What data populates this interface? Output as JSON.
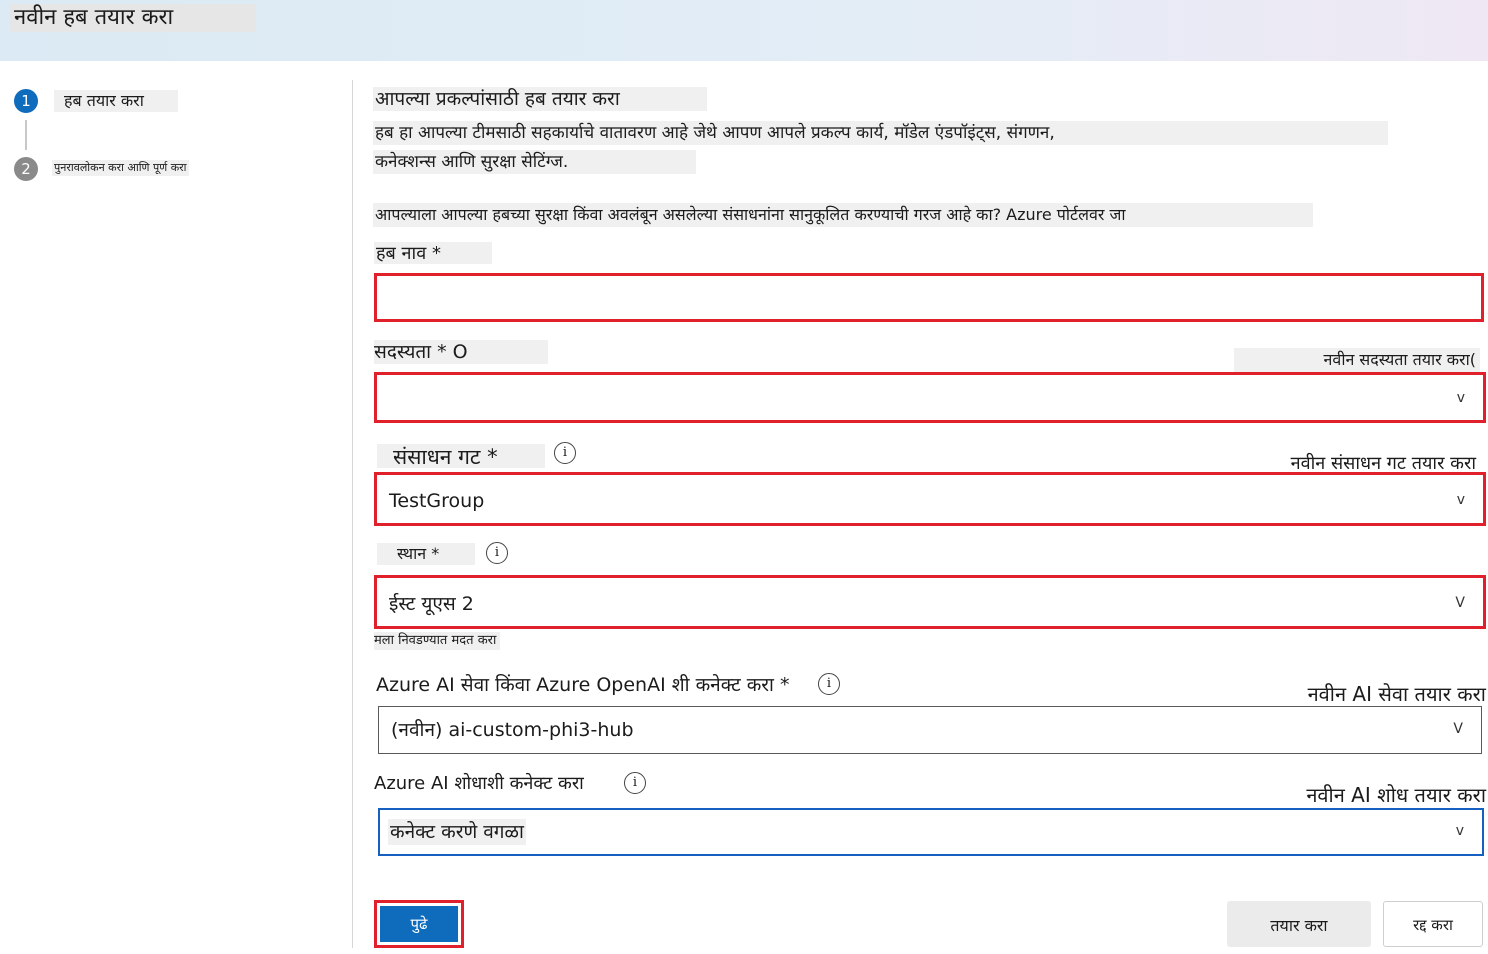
{
  "header": {
    "title": "नवीन हब तयार करा"
  },
  "steps": [
    {
      "number": "1",
      "label": "हब तयार करा"
    },
    {
      "number": "2",
      "label": "पुनरावलोकन करा आणि पूर्ण करा"
    }
  ],
  "main": {
    "section_title": "आपल्या प्रकल्पांसाठी हब तयार करा",
    "description_line1": "हब हा आपल्या टीमसाठी सहकार्याचे वातावरण आहे जेथे आपण आपले प्रकल्प कार्य, मॉडेल एंडपॉइंट्स, संगणन,",
    "description_line2": "कनेक्शन्स आणि सुरक्षा सेटिंग्ज.",
    "security_note": "आपल्याला आपल्या हबच्या सुरक्षा किंवा अवलंबून असलेल्या संसाधनांना सानुकूलित करण्याची गरज आहे का? Azure पोर्टलवर जा"
  },
  "form": {
    "hub_name": {
      "label": "हब नाव *",
      "value": ""
    },
    "subscription": {
      "label": "सदस्यता * O",
      "create_link": "नवीन सदस्यता तयार करा(",
      "value": "",
      "chevron": "v"
    },
    "resource_group": {
      "label": "संसाधन गट *",
      "create_link": "नवीन संसाधन गट तयार करा",
      "value": "TestGroup",
      "chevron": "v"
    },
    "location": {
      "label": "स्थान *",
      "value": "ईस्ट यूएस 2",
      "help_link": "मला निवडण्यात मदत करा",
      "chevron": "V"
    },
    "ai_services": {
      "label": "Azure AI सेवा किंवा Azure OpenAI शी कनेक्ट करा *",
      "create_link": "नवीन AI सेवा तयार करा",
      "value": "(नवीन) ai-custom-phi3-hub",
      "chevron": "V"
    },
    "ai_search": {
      "label": "Azure AI शोधाशी कनेक्ट करा",
      "create_link": "नवीन AI शोध तयार करा",
      "value": "कनेक्ट करणे वगळा",
      "chevron": "v"
    },
    "info_glyph": "i"
  },
  "footer": {
    "next_label": "पुढे",
    "create_label": "तयार करा",
    "cancel_label": "रद्द करा"
  },
  "colors": {
    "accent": "#0f6cbd",
    "highlight_border": "#e0202a",
    "focus_border": "#1560c0"
  }
}
